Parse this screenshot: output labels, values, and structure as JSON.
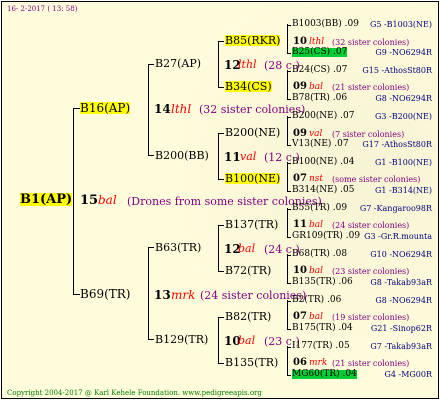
{
  "header": "16- 2-2017 ( 13: 58)",
  "footer": "Copyright 2004-2017 @ Karl Kehele Foundation.   www.pedigreeapis.org",
  "root": {
    "name": "B1(AP)",
    "num": "15",
    "mark": "bal",
    "note": "(Drones from some sister colonies)"
  },
  "g1": [
    {
      "name": "B16(AP)",
      "num": "14",
      "mark": "lthl",
      "note": "(32 sister colonies)"
    },
    {
      "name": "B69(TR)",
      "num": "13",
      "mark": "mrk",
      "note": "(24 sister colonies)"
    }
  ],
  "g2": [
    {
      "name": "B27(AP)",
      "num": "12",
      "mark": "lthl",
      "note": "(28 c.)"
    },
    {
      "name": "B200(BB)",
      "num": "11",
      "mark": "val",
      "note": "(12 c.)"
    },
    {
      "name": "B63(TR)",
      "num": "12",
      "mark": "bal",
      "note": "(24 c.)"
    },
    {
      "name": "B129(TR)",
      "num": "10",
      "mark": "bal",
      "note": "(23 c.)"
    }
  ],
  "g3": [
    {
      "name": "B85(RKR)"
    },
    {
      "name": "B34(CS)"
    },
    {
      "name": "B200(NE)"
    },
    {
      "name": "B100(NE)"
    },
    {
      "name": "B137(TR)"
    },
    {
      "name": "B72(TR)"
    },
    {
      "name": "B82(TR)"
    },
    {
      "name": "B135(TR)"
    }
  ],
  "g4": [
    {
      "a": "B1003(BB) .09",
      "b": "G5 -B1003(NE)"
    },
    {
      "num": "10",
      "mark": "lthl",
      "note": "(32 sister colonies)"
    },
    {
      "a": "B25(CS) .07",
      "b": "G9 -NO6294R"
    },
    {
      "a": "B24(CS) .07",
      "b": "G15 -AthosSt80R"
    },
    {
      "num": "09",
      "mark": "bal",
      "note": "(21 sister colonies)"
    },
    {
      "a": "B78(TR) .06",
      "b": "G8 -NO6294R"
    },
    {
      "a": "B200(NE) .07",
      "b": "G3 -B200(NE)"
    },
    {
      "num": "09",
      "mark": "val",
      "note": "(7 sister colonies)"
    },
    {
      "a": "V13(NE) .07",
      "b": "G17 -AthosSt80R"
    },
    {
      "a": "B100(NE) .04",
      "b": "G1 -B100(NE)"
    },
    {
      "num": "07",
      "mark": "nst",
      "note": "(some sister colonies)"
    },
    {
      "a": "B314(NE) .05",
      "b": "G1 -B314(NE)"
    },
    {
      "a": "B55(TR) .09",
      "b": "G7 -Kangaroo98R"
    },
    {
      "num": "11",
      "mark": "bal",
      "note": "(24 sister colonies)"
    },
    {
      "a": "GR109(TR) .09",
      "b": "G3 -Gr.R.mounta"
    },
    {
      "a": "B68(TR) .08",
      "b": "G10 -NO6294R"
    },
    {
      "num": "10",
      "mark": "bal",
      "note": "(23 sister colonies)"
    },
    {
      "a": "B135(TR) .06",
      "b": "G8 -Takab93aR"
    },
    {
      "a": "B2(TR) .06",
      "b": "G8 -NO6294R"
    },
    {
      "num": "07",
      "mark": "bal",
      "note": "(19 sister colonies)"
    },
    {
      "a": "B175(TR) .04",
      "b": "G21 -Sinop62R"
    },
    {
      "a": "I177(TR) .05",
      "b": "G7 -Takab93aR"
    },
    {
      "num": "06",
      "mark": "mrk",
      "note": "(21 sister colonies)"
    },
    {
      "a": "MG60(TR) .04",
      "b": "G4 -MG00R"
    }
  ]
}
